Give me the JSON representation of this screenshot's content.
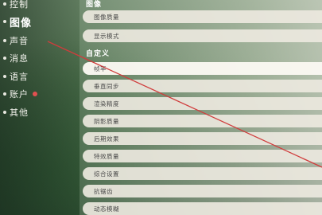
{
  "sidebar": {
    "items": [
      {
        "label": "控制"
      },
      {
        "label": "图像"
      },
      {
        "label": "声音"
      },
      {
        "label": "消息"
      },
      {
        "label": "语言"
      },
      {
        "label": "账户"
      },
      {
        "label": "其他"
      }
    ],
    "active_index": 1
  },
  "main": {
    "section_image_title": "图像",
    "section_image_rows": [
      {
        "label": "图像质量"
      },
      {
        "label": "显示模式"
      }
    ],
    "section_custom_title": "自定义",
    "section_custom_rows": [
      {
        "label": "帧率"
      },
      {
        "label": "垂直同步"
      },
      {
        "label": "渲染精度"
      },
      {
        "label": "阴影质量"
      },
      {
        "label": "后期效果"
      },
      {
        "label": "特效质量"
      },
      {
        "label": "综合设置"
      },
      {
        "label": "抗锯齿"
      },
      {
        "label": "动态模糊"
      }
    ]
  },
  "colors": {
    "annotation_line": "#d03c3c",
    "badge": "#e05050"
  }
}
